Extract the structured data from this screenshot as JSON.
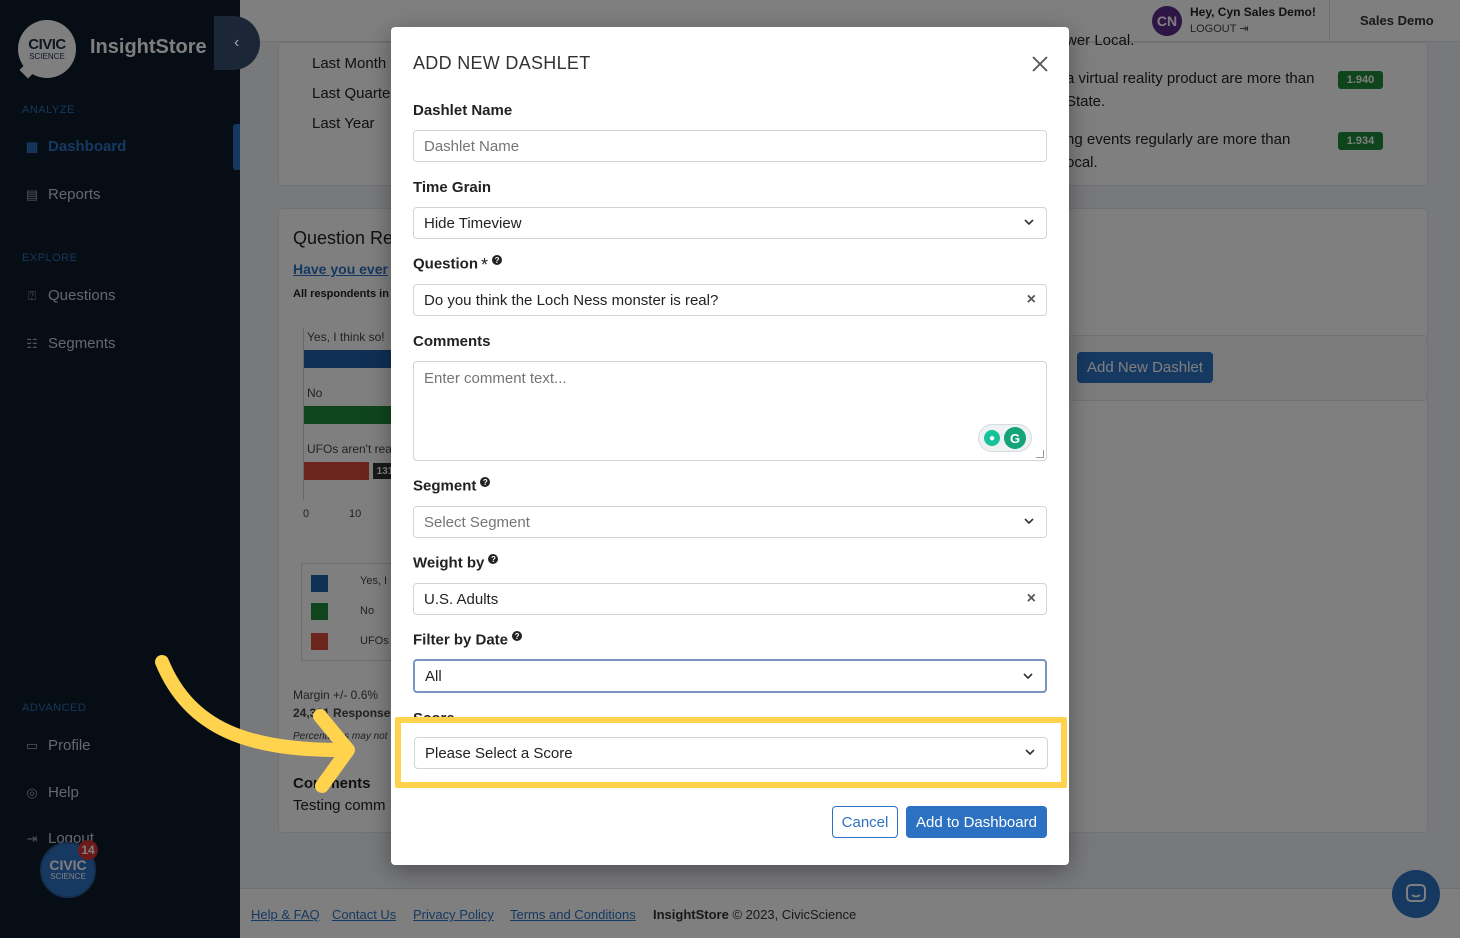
{
  "sidebar": {
    "logo_line1": "CIVIC",
    "logo_line2": "SCIENCE",
    "brand": "InsightStore",
    "collapse_icon": "chevron-left-icon",
    "sections": {
      "analyze": "ANALYZE",
      "explore": "EXPLORE",
      "advanced": "ADVANCED"
    },
    "items": [
      {
        "label": "Dashboard",
        "icon": "dashboard-icon",
        "active": true
      },
      {
        "label": "Reports",
        "icon": "report-icon"
      },
      {
        "label": "Questions",
        "icon": "question-icon"
      },
      {
        "label": "Segments",
        "icon": "segments-icon"
      },
      {
        "label": "Profile",
        "icon": "profile-icon"
      },
      {
        "label": "Help",
        "icon": "help-icon"
      },
      {
        "label": "Logout",
        "icon": "logout-icon"
      }
    ],
    "badge_line1": "CIVIC",
    "badge_line2": "SCIENCE",
    "badge_count": "14"
  },
  "topbar": {
    "avatar": "CN",
    "greeting": "Hey, Cyn Sales Demo!",
    "logout": "LOGOUT",
    "account": "Sales Demo"
  },
  "background": {
    "date_options": [
      "Last Month",
      "Last Quarte",
      "Last Year"
    ],
    "insights": [
      {
        "line1": "wer Local.",
        "line2": ""
      },
      {
        "line1": "a virtual reality product are more than",
        "line2": "State.",
        "score": "1.940"
      },
      {
        "line1": "ng events regularly are more than",
        "line2": "ocal.",
        "score": "1.934"
      }
    ],
    "question_title": "Question Re",
    "question_link": "Have you ever",
    "respondents": "All respondents in",
    "bar_labels": [
      "Yes, I think so!",
      "No",
      "UFOs aren't rea"
    ],
    "bar_value": "131",
    "axis_ticks": [
      "0",
      "10"
    ],
    "legend": [
      "Yes, I",
      "No",
      "UFOs"
    ],
    "margin": "Margin +/- 0.6%",
    "responses": "24,301 Responses",
    "note": "Percentages may not",
    "comments_title": "Comments",
    "comments_text": "Testing comm",
    "add_dashlet_button": "Add New Dashlet"
  },
  "footer": {
    "links": [
      "Help & FAQ",
      "Contact Us",
      "Privacy Policy",
      "Terms and Conditions"
    ],
    "brand": "InsightStore",
    "copyright": " © 2023, CivicScience"
  },
  "modal": {
    "title": "ADD NEW DASHLET",
    "fields": {
      "name_label": "Dashlet Name",
      "name_placeholder": "Dashlet Name",
      "grain_label": "Time Grain",
      "grain_value": "Hide Timeview",
      "question_label": "Question",
      "question_value": "Do you think the Loch Ness monster is real?",
      "comments_label": "Comments",
      "comments_placeholder": "Enter comment text...",
      "segment_label": "Segment",
      "segment_placeholder": "Select Segment",
      "weight_label": "Weight by",
      "weight_value": "U.S. Adults",
      "date_label": "Filter by Date",
      "date_value": "All",
      "score_label": "Score",
      "score_placeholder": "Please Select a Score"
    },
    "cancel": "Cancel",
    "add": "Add to Dashboard"
  },
  "colors": {
    "sidebar_bg": "#0f1a2a",
    "accent": "#2d72c2",
    "highlight": "#ffd34d",
    "bar_yes": "#1f5fa8",
    "bar_no": "#1f8a3a",
    "bar_ufo": "#d64a3a"
  }
}
